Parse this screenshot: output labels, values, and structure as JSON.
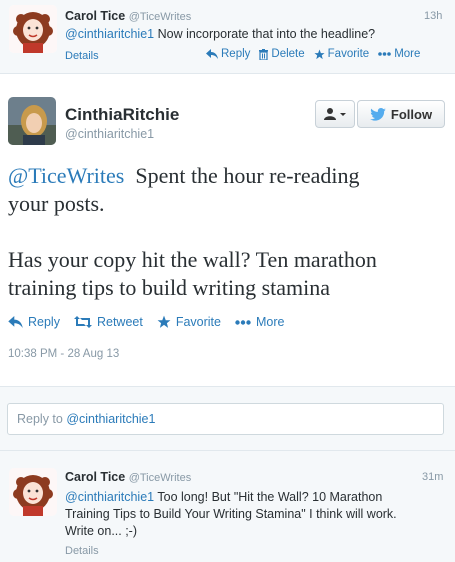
{
  "tweet_top": {
    "name": "Carol Tice",
    "handle": "@TiceWrites",
    "time": "13h",
    "mention": "@cinthiaritchie1",
    "text": " Now incorporate that into the headline?",
    "details": "Details",
    "actions": {
      "reply": "Reply",
      "delete": "Delete",
      "favorite": "Favorite",
      "more": "More"
    }
  },
  "focus_tweet": {
    "name": "CinthiaRitchie",
    "handle": "@cinthiaritchie1",
    "follow_label": "Follow",
    "mention": "@TiceWrites",
    "text_line1": "  Spent the hour re-reading",
    "text_line2": "your posts.",
    "text_line3": "Has your copy hit the wall? Ten marathon",
    "text_line4": "training tips to build writing stamina",
    "actions": {
      "reply": "Reply",
      "retweet": "Retweet",
      "favorite": "Favorite",
      "more": "More"
    },
    "timestamp": "10:38 PM - 28 Aug 13"
  },
  "reply_box": {
    "placeholder_prefix": "Reply to ",
    "placeholder_handle": "@cinthiaritchie1"
  },
  "tweet_bottom": {
    "name": "Carol Tice",
    "handle": "@TiceWrites",
    "time": "31m",
    "mention": "@cinthiaritchie1",
    "text_line1": " Too long! But \"Hit the Wall? 10 Marathon",
    "text_line2": "Training Tips to Build Your Writing Stamina\" I think will work.",
    "text_line3": "Write on... ;-)",
    "details": "Details"
  },
  "colors": {
    "link": "#2b7bb9",
    "muted": "#8899a6",
    "text": "#292f33"
  },
  "icons": [
    "avatar-carol",
    "avatar-cinthia",
    "reply-icon",
    "trash-icon",
    "star-icon",
    "dots-icon",
    "retweet-icon",
    "person-icon",
    "bird-icon"
  ]
}
